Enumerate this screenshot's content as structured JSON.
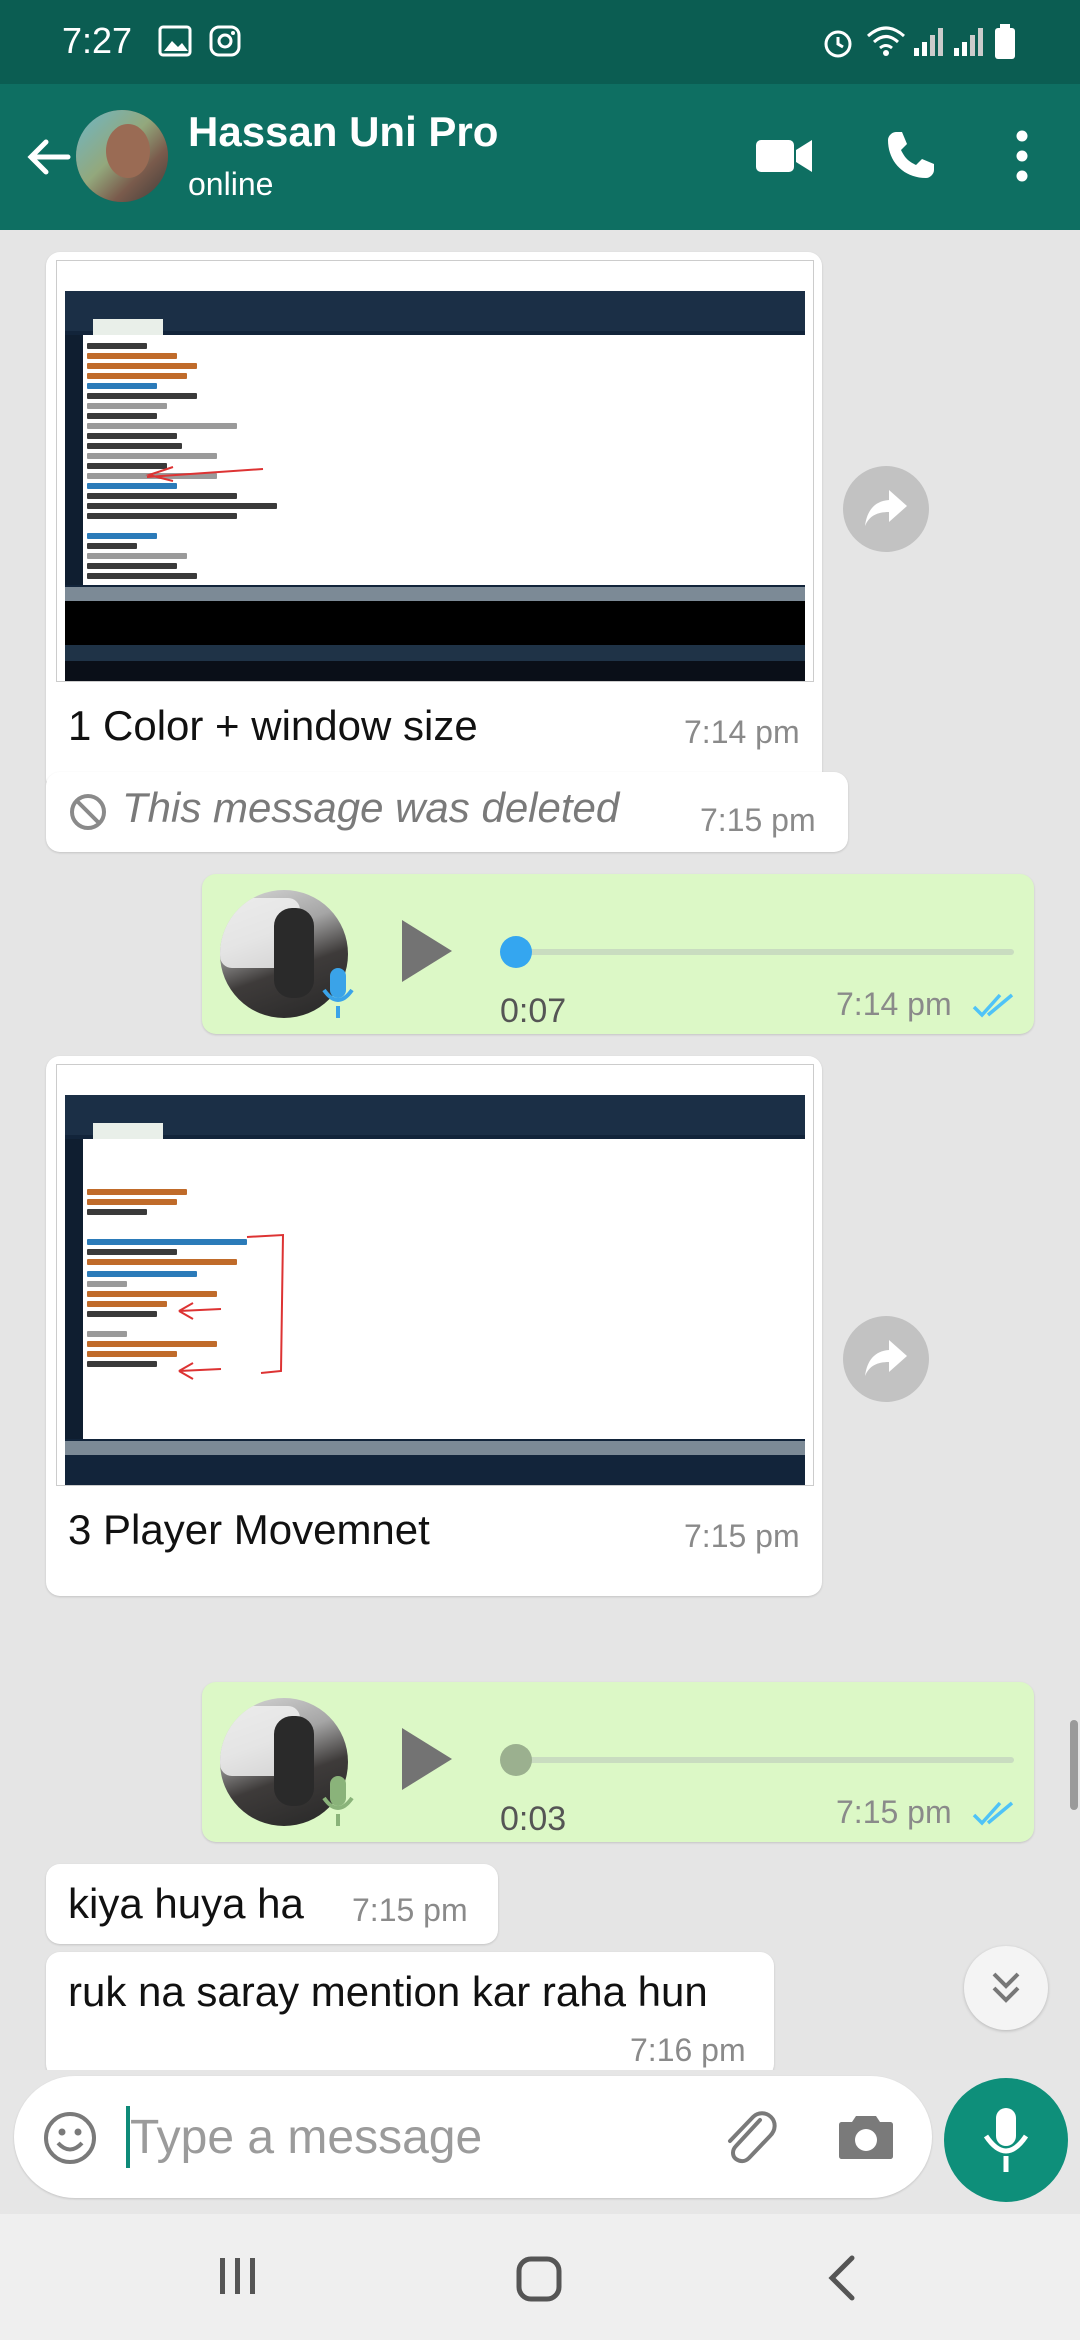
{
  "status_bar": {
    "time": "7:27"
  },
  "header": {
    "contact_name": "Hassan Uni Pro",
    "contact_status": "online"
  },
  "messages": [
    {
      "type": "image",
      "caption": "1 Color + window size",
      "time": "7:14 pm"
    },
    {
      "type": "deleted",
      "text": "This message was deleted",
      "time": "7:15 pm"
    },
    {
      "type": "voice",
      "duration": "0:07",
      "time": "7:14 pm",
      "progress": 0.0
    },
    {
      "type": "image",
      "caption": "3 Player Movemnet",
      "time": "7:15 pm"
    },
    {
      "type": "voice",
      "duration": "0:03",
      "time": "7:15 pm",
      "progress": 0.0
    },
    {
      "type": "text",
      "text": "kiya huya ha",
      "time": "7:15 pm"
    },
    {
      "type": "text",
      "text": "ruk na saray mention kar raha hun",
      "time": "7:16 pm"
    }
  ],
  "composer": {
    "placeholder": "Type a message"
  },
  "colors": {
    "header": "#0e6f62",
    "status_bar": "#0b5d52",
    "outgoing_bubble": "#dcf8c6",
    "incoming_bubble": "#ffffff",
    "read_ticks": "#4fc3f7",
    "fab": "#0e8f7a"
  },
  "icons": [
    "back-arrow-icon",
    "video-call-icon",
    "phone-icon",
    "more-vert-icon",
    "forward-icon",
    "blocked-icon",
    "play-icon",
    "mic-icon",
    "double-check-icon",
    "emoji-icon",
    "attach-icon",
    "camera-icon",
    "chevrons-down-icon",
    "recents-icon",
    "home-icon",
    "back-nav-icon"
  ]
}
